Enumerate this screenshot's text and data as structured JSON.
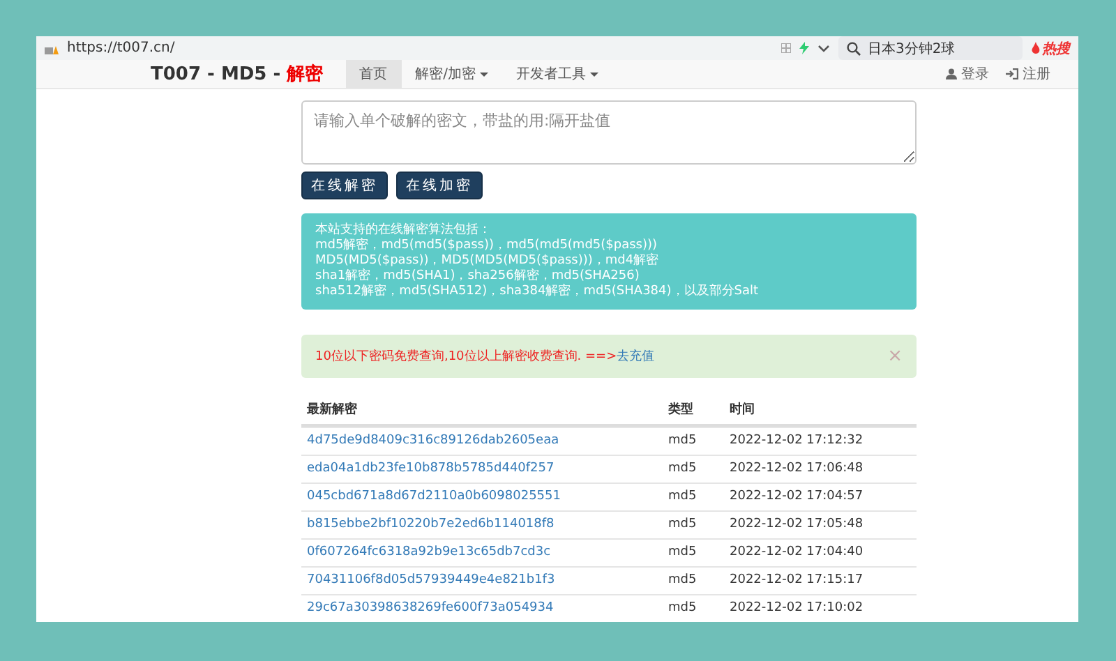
{
  "browser": {
    "url": "https://t007.cn/",
    "search": "日本3分钟2球",
    "hot_label": "热搜"
  },
  "navbar": {
    "brand": "T007 - MD5 - ",
    "brand_accent": "解密",
    "items": [
      {
        "label": "首页",
        "selected": true,
        "dropdown": false
      },
      {
        "label": "解密/加密",
        "selected": false,
        "dropdown": true
      },
      {
        "label": "开发者工具",
        "selected": false,
        "dropdown": true
      }
    ],
    "account": [
      {
        "label": "登录",
        "kind": "user"
      },
      {
        "label": "注册",
        "kind": "signin"
      }
    ]
  },
  "query": {
    "placeholder": "请输入单个破解的密文，带盐的用:隔开盐值"
  },
  "buttons": [
    "在线解密",
    "在线加密"
  ],
  "info_lines": [
    "本站支持的在线解密算法包括：",
    "md5解密，md5(md5($pass))，md5(md5(md5($pass)))",
    "MD5(MD5($pass))，MD5(MD5(MD5($pass)))，md4解密",
    "sha1解密，md5(SHA1)，sha256解密，md5(SHA256)",
    "sha512解密，md5(SHA512)，sha384解密，md5(SHA384)，以及部分Salt"
  ],
  "alert": {
    "text": "10位以下密码免费查询,10位以上解密收费查询. ==>",
    "link": "去充值",
    "close": "×"
  },
  "table": {
    "columns": [
      "最新解密",
      "类型",
      "时间"
    ],
    "rows": [
      [
        "4d75de9d8409c316c89126dab2605eaa",
        "md5",
        "2022-12-02 17:12:32"
      ],
      [
        "eda04a1db23fe10b878b5785d440f257",
        "md5",
        "2022-12-02 17:06:48"
      ],
      [
        "045cbd671a8d67d2110a0b6098025551",
        "md5",
        "2022-12-02 17:04:57"
      ],
      [
        "b815ebbe2bf10220b7e2ed6b114018f8",
        "md5",
        "2022-12-02 17:05:48"
      ],
      [
        "0f607264fc6318a92b9e13c65db7cd3c",
        "md5",
        "2022-12-02 17:04:40"
      ],
      [
        "70431106f8d05d57939449e4e821b1f3",
        "md5",
        "2022-12-02 17:15:17"
      ],
      [
        "29c67a30398638269fe600f73a054934",
        "md5",
        "2022-12-02 17:10:02"
      ]
    ]
  }
}
